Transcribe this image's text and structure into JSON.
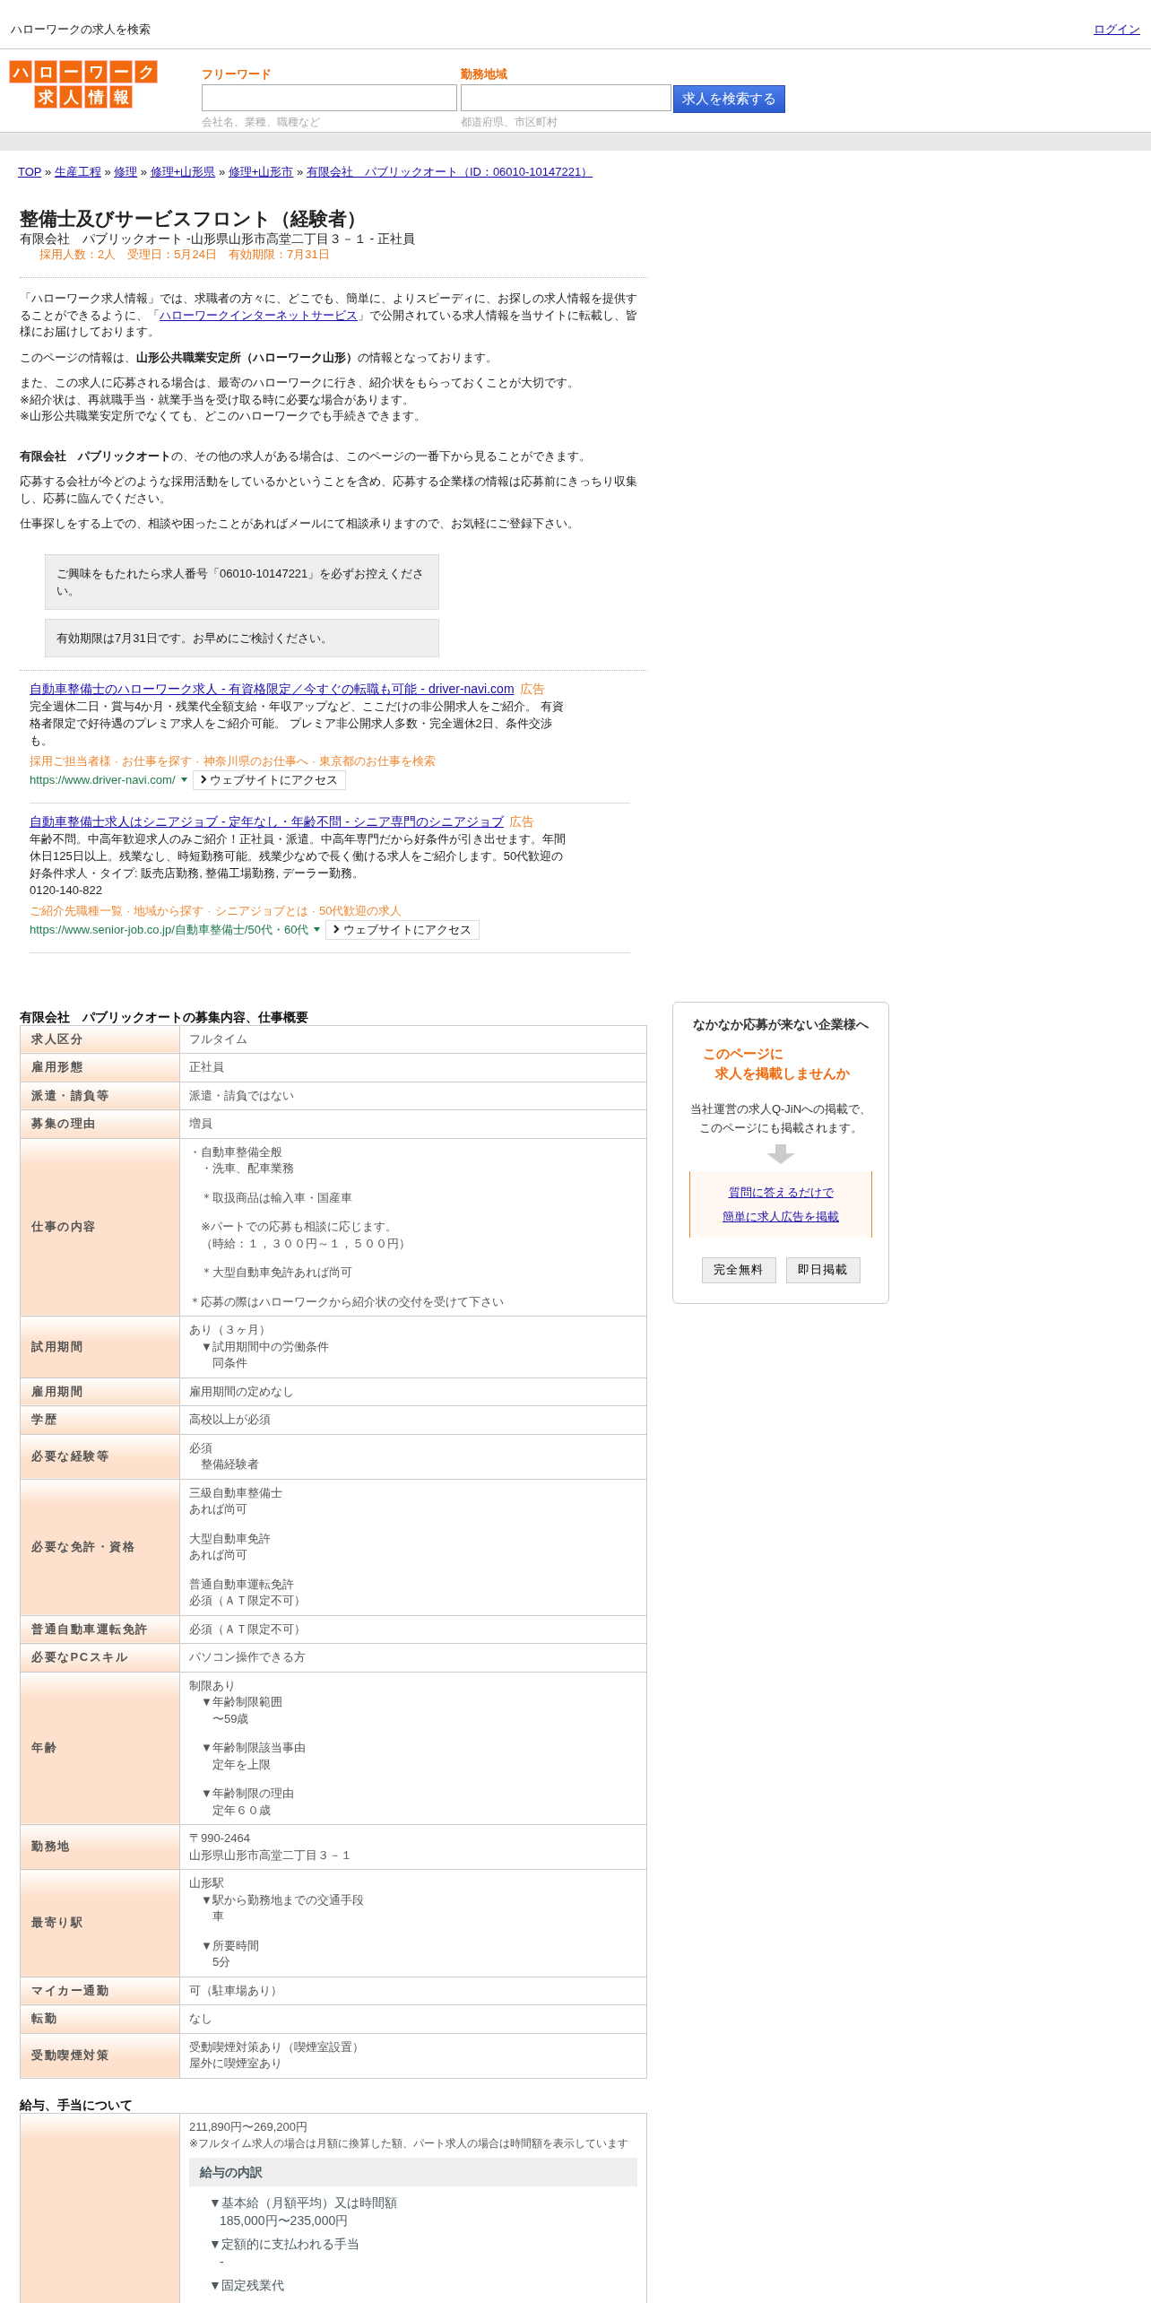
{
  "top_bar": {
    "title": "ハローワークの求人を検索",
    "login_link": "ログイン"
  },
  "header": {
    "logo": [
      "ハローワーク",
      "求人情報"
    ],
    "search_fields": [
      {
        "label": "フリーワード",
        "hint": "会社名、業種、職種など"
      },
      {
        "label": "勤務地域",
        "hint": "都道府県、市区町村"
      }
    ],
    "search_button": "求人を検索する"
  },
  "breadcrumb": {
    "separator": "»",
    "items": [
      "TOP",
      "生産工程",
      "修理",
      "修理+山形県",
      "修理+山形市",
      "有限会社　パブリックオート（ID：06010-10147221）"
    ]
  },
  "job": {
    "title": "整備士及びサービスフロント（経験者）",
    "subtitle": "有限会社　パブリックオート -山形県山形市高堂二丁目３－１ - 正社員",
    "meta": "採用人数：2人　受理日：5月24日　有効期限：7月31日"
  },
  "intro": {
    "notice": {
      "before": "「ハローワーク求人情報」では、求職者の方々に、どこでも、簡単に、よりスピーディに、お探しの求人情報を提供することができるように、「",
      "link": "ハローワークインターネットサービス",
      "after": "」で公開されている求人情報を当サイトに転載し、皆様にお届けしております。"
    },
    "paragraphs": [
      [
        "このページの情報は、**山形公共職業安定所（ハローワーク山形）**の情報となっております。"
      ],
      [
        "また、この求人に応募される場合は、最寄のハローワークに行き、紹介状をもらっておくことが大切です。",
        "※紹介状は、再就職手当・就業手当を受け取る時に必要な場合があります。",
        "※山形公共職業安定所でなくても、どこのハローワークでも手続きできます。"
      ]
    ]
  },
  "company_notes": [
    [
      "**有限会社　パブリックオート**の、その他の求人がある場合は、このページの一番下から見ることができます。"
    ],
    [
      "応募する会社が今どのような採用活動をしているかということを含め、応募する企業様の情報は応募前にきっちり収集し、応募に臨んでください。"
    ],
    [
      "仕事探しをする上での、相談や困ったことがあればメールにて相談承りますので、お気軽にご登録下さい。"
    ]
  ],
  "reminders": [
    "ご興味をもたれたら求人番号「06010-10147221」を必ずお控えください。",
    "有効期限は7月31日です。お早めにご検討ください。"
  ],
  "ad_separator": "·",
  "ads": [
    {
      "title": "自動車整備士のハローワーク求人 - 有資格限定／今すぐの転職も可能 - driver-navi.com",
      "label": "広告",
      "description": "完全週休二日・賞与4か月・残業代全額支給・年収アップなど、ここだけの非公開求人をご紹介。 有資格者限定で好待遇のプレミア求人をご紹介可能。 プレミア非公開求人多数・完全週休2日、条件交渉も。",
      "sitelinks": [
        "採用ご担当者様",
        "お仕事を探す",
        "神奈川県のお仕事へ",
        "東京都のお仕事を検索"
      ],
      "url": "https://www.driver-navi.com/",
      "visit_button": "ウェブサイトにアクセス"
    },
    {
      "title": "自動車整備士求人はシニアジョブ - 定年なし・年齢不問 - シニア専門のシニアジョブ",
      "label": "広告",
      "description": "年齢不問。中高年歓迎求人のみご紹介！正社員・派遣。中高年専門だから好条件が引き出せます。年間休日125日以上。残業なし、時短勤務可能。残業少なめで長く働ける求人をご紹介します。50代歓迎の好条件求人・タイプ: 販売店勤務, 整備工場勤務, デーラー勤務。",
      "phone": "0120-140-822",
      "sitelinks": [
        "ご紹介先職種一覧",
        "地域から探す",
        "シニアジョブとは",
        "50代歓迎の求人"
      ],
      "url": "https://www.senior-job.co.jp/自動車整備士/50代・60代",
      "visit_button": "ウェブサイトにアクセス"
    }
  ],
  "job_table": {
    "title": "有限会社　パブリックオートの募集内容、仕事概要",
    "rows": [
      {
        "label": "求人区分",
        "value": [
          [
            "フルタイム"
          ]
        ]
      },
      {
        "label": "雇用形態",
        "value": [
          [
            "正社員"
          ]
        ]
      },
      {
        "label": "派遣・請負等",
        "value": [
          [
            "派遣・請負ではない"
          ]
        ]
      },
      {
        "label": "募集の理由",
        "value": [
          [
            "増員"
          ]
        ]
      },
      {
        "label": "仕事の内容",
        "value": [
          [
            "・自動車整備全般",
            "　・洗車、配車業務"
          ],
          [
            "　＊取扱商品は輸入車・国産車"
          ],
          [
            "　※パートでの応募も相談に応じます。",
            "　（時給：１，３００円～１，５００円）"
          ],
          [
            "　＊大型自動車免許あれば尚可"
          ],
          [
            "＊応募の際はハローワークから紹介状の交付を受けて下さい"
          ]
        ]
      },
      {
        "label": "試用期間",
        "value": [
          [
            "あり（３ヶ月）",
            "　▼試用期間中の労働条件",
            "　　同条件"
          ]
        ]
      },
      {
        "label": "雇用期間",
        "value": [
          [
            "雇用期間の定めなし"
          ]
        ]
      },
      {
        "label": "学歴",
        "value": [
          [
            "高校以上が必須"
          ]
        ]
      },
      {
        "label": "必要な経験等",
        "value": [
          [
            "必須",
            "　整備経験者"
          ]
        ]
      },
      {
        "label": "必要な免許・資格",
        "value": [
          [
            "三級自動車整備士",
            "あれば尚可"
          ],
          [
            "大型自動車免許",
            "あれば尚可"
          ],
          [
            "普通自動車運転免許",
            "必須（ＡＴ限定不可）"
          ]
        ]
      },
      {
        "label": "普通自動車運転免許",
        "value": [
          [
            "必須（ＡＴ限定不可）"
          ]
        ]
      },
      {
        "label": "必要なPCスキル",
        "value": [
          [
            "パソコン操作できる方"
          ]
        ]
      },
      {
        "label": "年齢",
        "value": [
          [
            "制限あり",
            "　▼年齢制限範囲",
            "　　〜59歳"
          ],
          [
            "　▼年齢制限該当事由",
            "　　定年を上限"
          ],
          [
            "　▼年齢制限の理由",
            "　　定年６０歳"
          ]
        ]
      },
      {
        "label": "勤務地",
        "value": [
          [
            "〒990-2464",
            "山形県山形市高堂二丁目３－１"
          ]
        ]
      },
      {
        "label": "最寄り駅",
        "value": [
          [
            "山形駅",
            "　▼駅から勤務地までの交通手段",
            "　　車"
          ],
          [
            "　▼所要時間",
            "　　5分"
          ]
        ]
      },
      {
        "label": "マイカー通勤",
        "value": [
          [
            "可（駐車場あり）"
          ]
        ]
      },
      {
        "label": "転勤",
        "value": [
          [
            "なし"
          ]
        ]
      },
      {
        "label": "受動喫煙対策",
        "value": [
          [
            "受動喫煙対策あり（喫煙室設置）",
            "屋外に喫煙室あり"
          ]
        ]
      }
    ]
  },
  "side_panel": {
    "title": "なかなか応募が来ない企業様へ",
    "catch": [
      "このページに",
      "求人を掲載しませんか"
    ],
    "text": "当社運営の求人Q-JiNへの掲載で、このページにも掲載されます。",
    "links": [
      "質問に答えるだけで",
      "簡単に求人広告を掲載"
    ],
    "buttons": [
      "完全無料",
      "即日掲載"
    ]
  },
  "salary": {
    "title": "給与、手当について",
    "amount": "211,890円〜269,200円",
    "note": "※フルタイム求人の場合は月額に換算した額、パート求人の場合は時間額を表示しています",
    "breakdown_title": "給与の内訳",
    "items": [
      {
        "heading": "▼基本給（月額平均）又は時間額",
        "value": "185,000円〜235,000円"
      },
      {
        "heading": "▼定額的に支払われる手当",
        "value": "-"
      },
      {
        "heading": "▼固定残業代"
      }
    ]
  }
}
